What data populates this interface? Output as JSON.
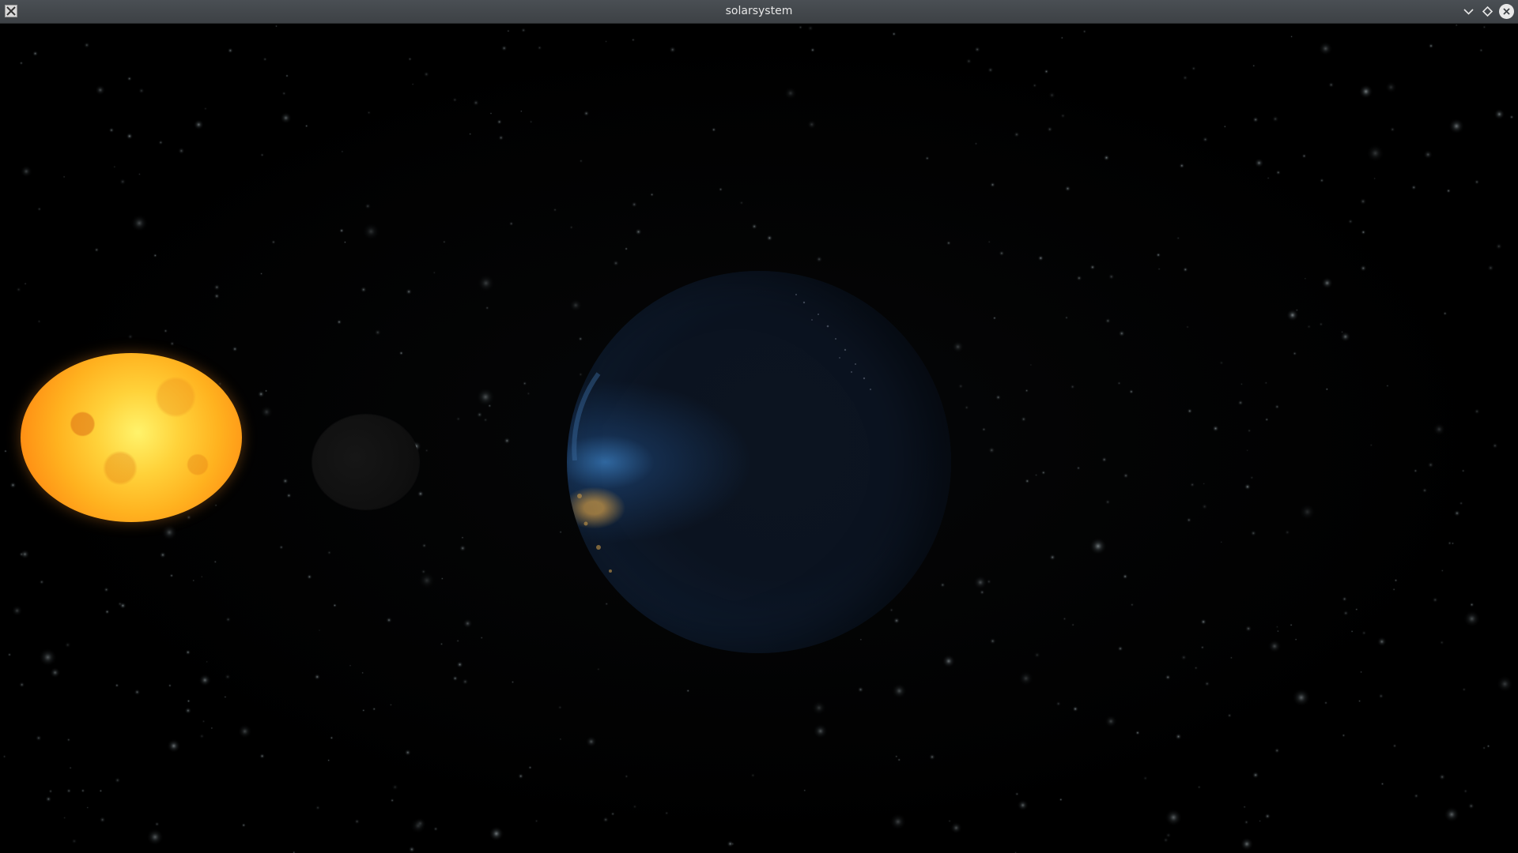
{
  "window": {
    "title": "solarsystem",
    "app_icon": "x-window-icon",
    "controls": {
      "minimize_icon": "chevron-down-icon",
      "maximize_icon": "diamond-icon",
      "close_icon": "close-circle-icon"
    }
  },
  "scene": {
    "background_color": "#000000",
    "bodies": [
      {
        "name": "sun",
        "color": "#ffb21f"
      },
      {
        "name": "moon",
        "color": "#121212"
      },
      {
        "name": "earth",
        "color": "#0c1420"
      }
    ]
  }
}
